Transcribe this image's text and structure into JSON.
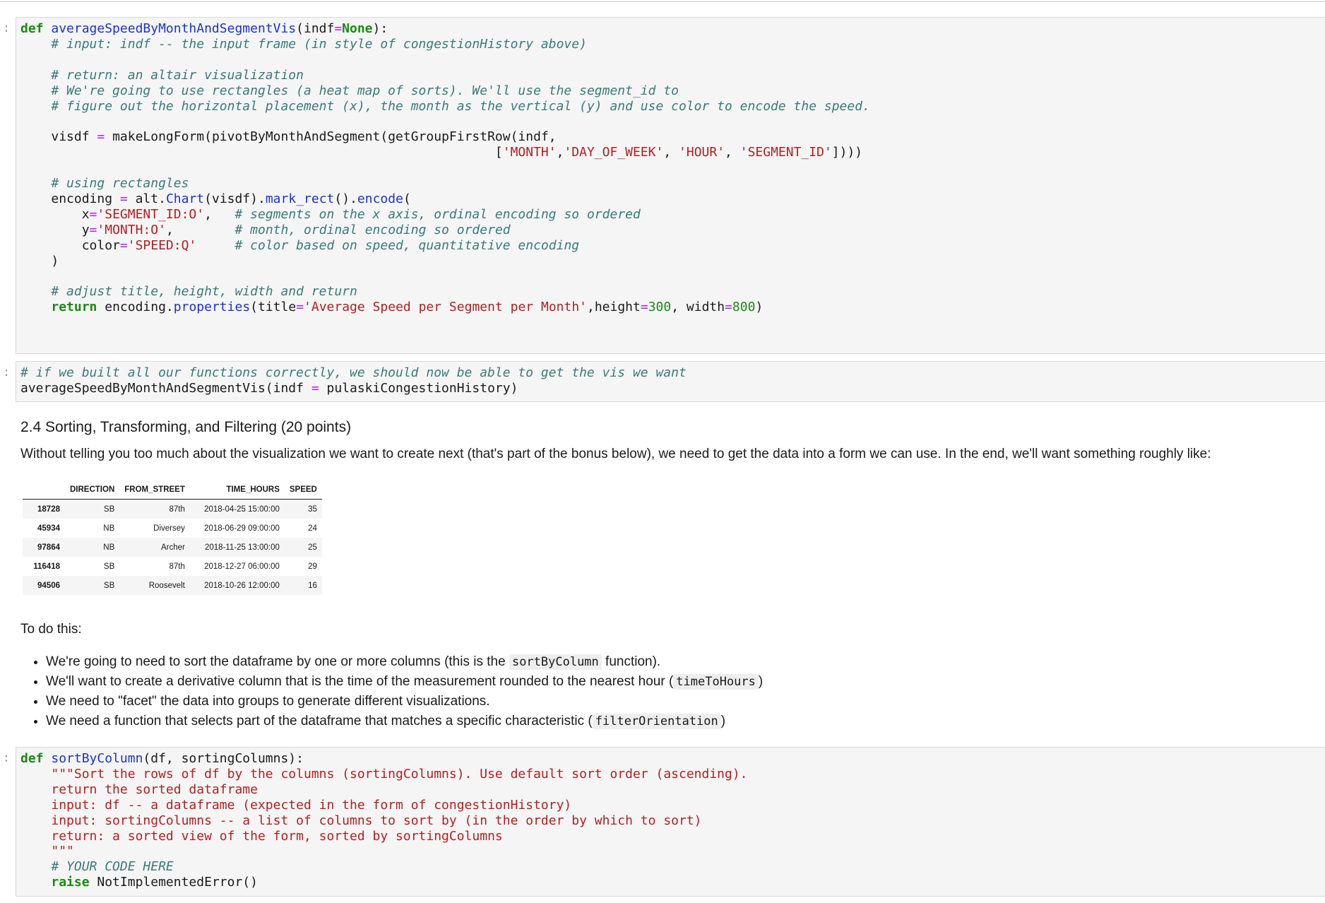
{
  "cell_prompt": ":",
  "cell1": {
    "def_kw": "def",
    "func_name": "averageSpeedByMonthAndSegmentVis",
    "params_open": "(indf",
    "eq": "=",
    "none_kw": "None",
    "params_close": "):",
    "comment_input": "# input: indf -- the input frame (in style of congestionHistory above)",
    "comment_return": "# return: an altair visualization",
    "comment_rects1": "# We're going to use rectangles (a heat map of sorts). We'll use the segment_id to",
    "comment_rects2": "# figure out the horizontal placement (x), the month as the vertical (y) and use color to encode the speed.",
    "visdf_var": "visdf",
    "visdf_call": "makeLongForm(pivotByMonthAndSegment(getGroupFirstRow(indf,",
    "list_open": "[",
    "list_item_month": "'MONTH'",
    "list_item_dow": "'DAY_OF_WEEK'",
    "list_item_hour": "'HOUR'",
    "list_item_seg": "'SEGMENT_ID'",
    "list_close": "])))",
    "comment_using": "# using rectangles",
    "encoding_var": "encoding",
    "alt_prefix": "alt.",
    "chart_fn": "Chart",
    "chart_arg": "(visdf).",
    "mark_rect_fn": "mark_rect",
    "paren_dot": "().",
    "encode_fn": "encode",
    "open_paren": "(",
    "x_key": "x",
    "x_val": "'SEGMENT_ID:O'",
    "x_comment": "# segments on the x axis, ordinal encoding so ordered",
    "y_key": "y",
    "y_val": "'MONTH:O'",
    "y_comment": "# month, ordinal encoding so ordered",
    "color_key": "color",
    "color_val": "'SPEED:Q'",
    "color_comment": "# color based on speed, quantitative encoding",
    "close_paren": ")",
    "comment_adjust": "# adjust title, height, width and return",
    "return_kw": "return",
    "return_obj": "encoding.",
    "properties_fn": "properties",
    "title_key": "(title",
    "title_val": "'Average Speed per Segment per Month'",
    "height_key": ",height",
    "height_val": "300",
    "width_key": ", width",
    "width_val": "800",
    "end_paren": ")"
  },
  "cell2": {
    "comment": "# if we built all our functions correctly, we should now be able to get the vis we want",
    "call": "averageSpeedByMonthAndSegmentVis(indf ",
    "eq": "=",
    "arg": " pulaskiCongestionHistory)"
  },
  "section": {
    "heading": "2.4 Sorting, Transforming, and Filtering (20 points)",
    "intro": "Without telling you too much about the visualization we want to create next (that's part of the bonus below), we need to get the data into a form we can use. In the end, we'll want something roughly like:",
    "table": {
      "columns": [
        "",
        "DIRECTION",
        "FROM_STREET",
        "TIME_HOURS",
        "SPEED"
      ],
      "rows": [
        {
          "index": "18728",
          "direction": "SB",
          "from_street": "87th",
          "time_hours": "2018-04-25 15:00:00",
          "speed": "35"
        },
        {
          "index": "45934",
          "direction": "NB",
          "from_street": "Diversey",
          "time_hours": "2018-06-29 09:00:00",
          "speed": "24"
        },
        {
          "index": "97864",
          "direction": "NB",
          "from_street": "Archer",
          "time_hours": "2018-11-25 13:00:00",
          "speed": "25"
        },
        {
          "index": "116418",
          "direction": "SB",
          "from_street": "87th",
          "time_hours": "2018-12-27 06:00:00",
          "speed": "29"
        },
        {
          "index": "94506",
          "direction": "SB",
          "from_street": "Roosevelt",
          "time_hours": "2018-10-26 12:00:00",
          "speed": "16"
        }
      ]
    },
    "todo": "To do this:",
    "bullets": [
      {
        "before": "We're going to need to sort the dataframe by one or more columns (this is the ",
        "code": "sortByColumn",
        "after": " function)."
      },
      {
        "before": "We'll want to create a derivative column that is the time of the measurement rounded to the nearest hour (",
        "code": "timeToHours",
        "after": ")"
      },
      {
        "before": "We need to \"facet\" the data into groups to generate different visualizations.",
        "code": "",
        "after": ""
      },
      {
        "before": "We need a function that selects part of the dataframe that matches a specific characteristic (",
        "code": "filterOrientation",
        "after": ")"
      }
    ]
  },
  "cell3": {
    "def_kw": "def",
    "func_name": "sortByColumn",
    "params": "(df, sortingColumns):",
    "doc1": "\"\"\"Sort the rows of df by the columns (sortingColumns). Use default sort order (ascending).",
    "doc2": "return the sorted dataframe",
    "doc3": "input: df -- a dataframe (expected in the form of congestionHistory)",
    "doc4": "input: sortingColumns -- a list of columns to sort by (in the order by which to sort)",
    "doc5": "return: a sorted view of the form, sorted by sortingColumns",
    "doc6": "\"\"\"",
    "comment": "# YOUR CODE HERE",
    "raise_kw": "raise",
    "raise_rest": " NotImplementedError()"
  }
}
